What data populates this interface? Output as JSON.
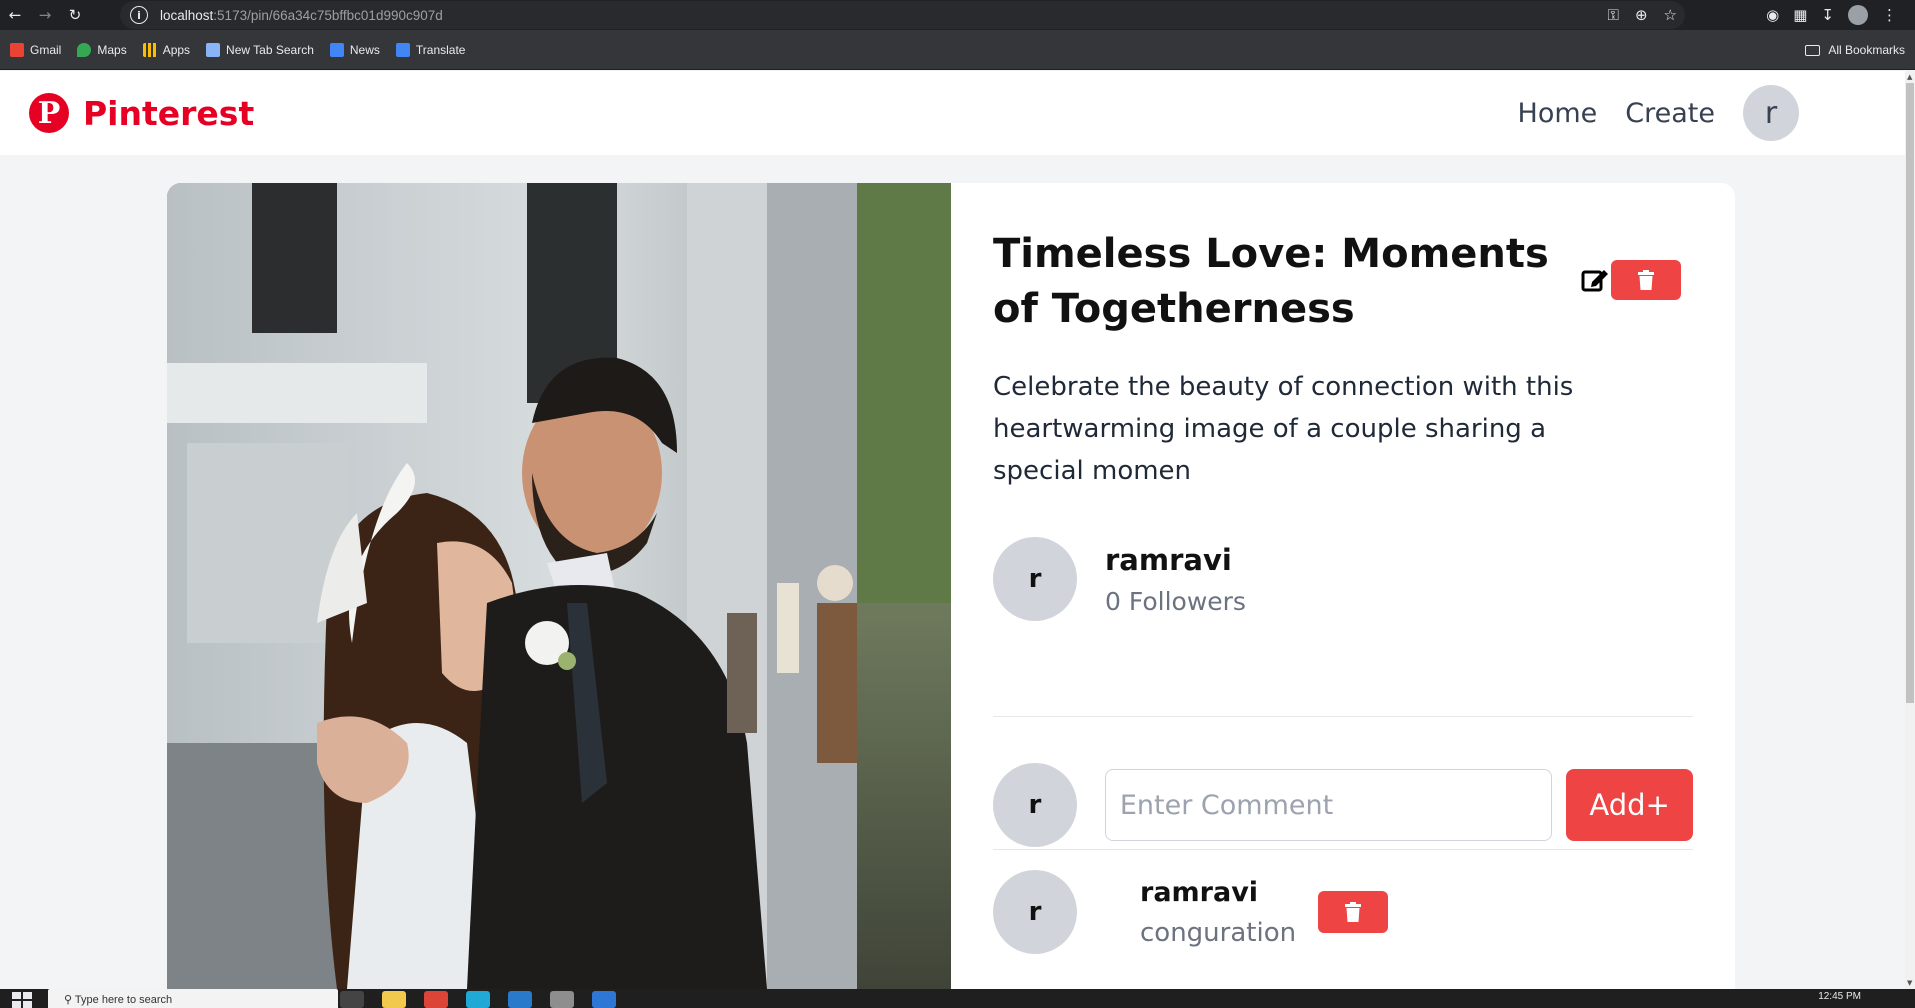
{
  "browser": {
    "url_host": "localhost",
    "url_path": ":5173/pin/66a34c75bffbc01d990c907d",
    "bookmarks": [
      {
        "label": "Gmail",
        "color": "#ea4335"
      },
      {
        "label": "Maps",
        "color": "#34a853"
      },
      {
        "label": "Apps",
        "color": "#fbbc04"
      },
      {
        "label": "New Tab Search",
        "color": "#8ab4f8"
      },
      {
        "label": "News",
        "color": "#4285f4"
      },
      {
        "label": "Translate",
        "color": "#4285f4"
      }
    ],
    "all_bookmarks": "All Bookmarks"
  },
  "header": {
    "logo_text": "Pinterest",
    "logo_letter": "P",
    "nav": {
      "home": "Home",
      "create": "Create"
    },
    "avatar_letter": "r"
  },
  "pin": {
    "title": "Timeless Love: Moments of Togetherness",
    "description": "Celebrate the beauty of connection with this heartwarming image of a couple sharing a special momen",
    "author": {
      "avatar_letter": "r",
      "name": "ramravi",
      "followers": "0 Followers"
    }
  },
  "comment_form": {
    "avatar_letter": "r",
    "placeholder": "Enter Comment",
    "value": "",
    "add_label": "Add+"
  },
  "comments": [
    {
      "avatar_letter": "r",
      "author": "ramravi",
      "text": "conguration"
    }
  ],
  "taskbar": {
    "search_placeholder": "Type here to search",
    "time": "12:45 PM"
  },
  "colors": {
    "brand": "#e60023",
    "danger": "#ef4444",
    "page_bg": "#f3f4f6"
  }
}
